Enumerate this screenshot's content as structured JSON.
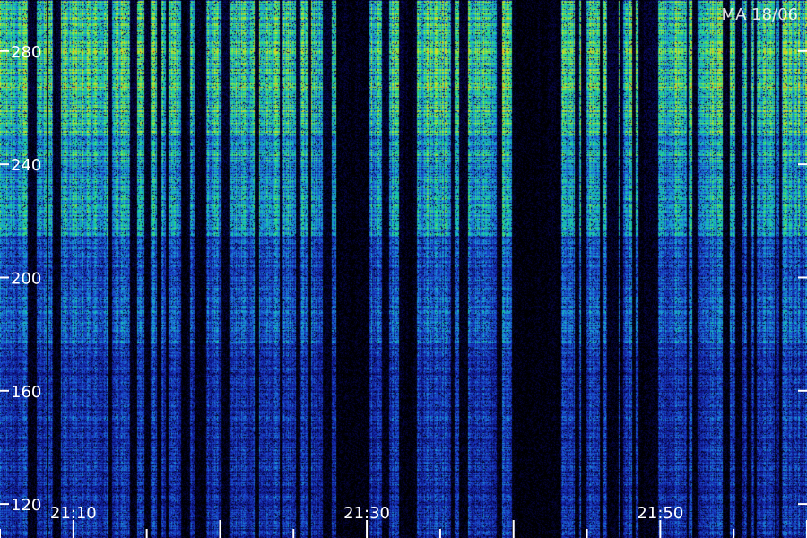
{
  "station_label": "MA 18/06",
  "chart_data": {
    "type": "heatmap",
    "title": "",
    "xlabel": "",
    "ylabel": "",
    "x_tick_labels": [
      "21:10",
      "21:30",
      "21:50"
    ],
    "x_tick_minutes": [
      10,
      30,
      50
    ],
    "xlim_minutes": [
      5,
      60
    ],
    "y_ticks": [
      120,
      160,
      200,
      240,
      280
    ],
    "ylim": [
      108,
      298
    ],
    "colormap": [
      "#000000",
      "#0a0a6e",
      "#1a3cc8",
      "#1aa0d8",
      "#18d890",
      "#9ae23a",
      "#e0e020",
      "#ff8c1a",
      "#ff2a10"
    ],
    "intensity_bands": [
      {
        "y_from": 108,
        "y_to": 175,
        "level": 0.35
      },
      {
        "y_from": 175,
        "y_to": 215,
        "level": 0.45
      },
      {
        "y_from": 215,
        "y_to": 250,
        "level": 0.62
      },
      {
        "y_from": 250,
        "y_to": 298,
        "level": 0.78
      }
    ],
    "bright_lines_y": [
      280,
      268,
      244
    ],
    "dark_gaps_minutes": [
      28.5,
      29.5,
      40.5,
      41.5,
      42.5
    ]
  }
}
